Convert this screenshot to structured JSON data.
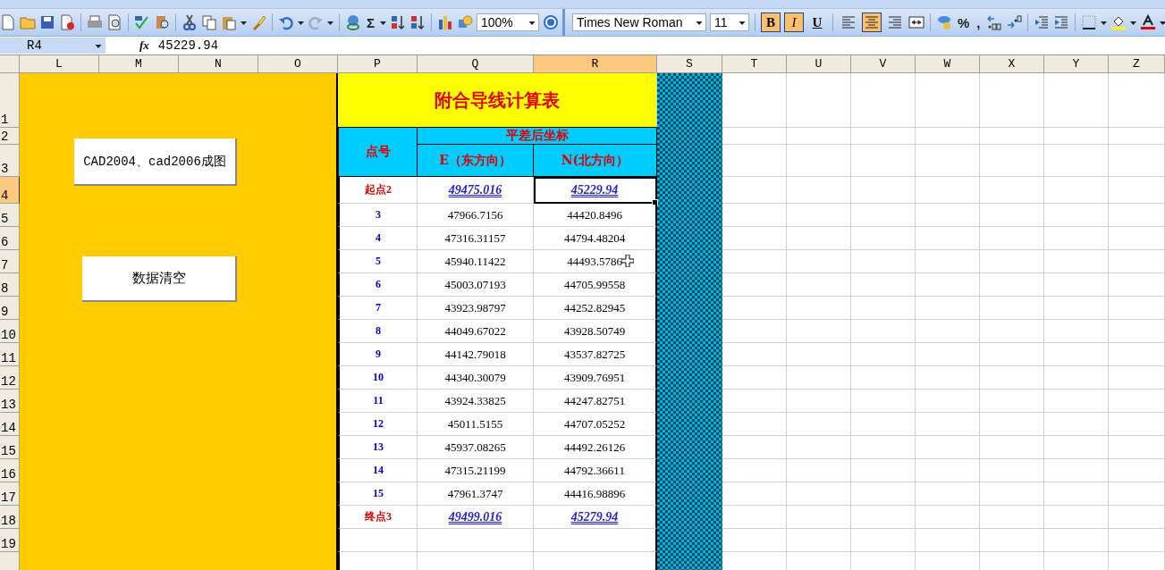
{
  "toolbar": {
    "sigma": "Σ",
    "zoom": "100%",
    "font": "Times New Roman",
    "font_size": "11",
    "style_buttons": [
      {
        "label": "B",
        "selected": true
      },
      {
        "label": "I",
        "selected": true
      },
      {
        "label": "U",
        "selected": false
      }
    ],
    "alignment": [
      {
        "selected": false
      },
      {
        "selected": true
      },
      {
        "selected": false
      }
    ],
    "percent": "%",
    "comma": ","
  },
  "formula_bar": {
    "name_box": "R4",
    "fx": "fx",
    "formula": "45229.94"
  },
  "columns": [
    {
      "label": "L",
      "selected": false
    },
    {
      "label": "M",
      "selected": false
    },
    {
      "label": "N",
      "selected": false
    },
    {
      "label": "O",
      "selected": false
    },
    {
      "label": "P",
      "selected": false
    },
    {
      "label": "Q",
      "selected": false
    },
    {
      "label": "R",
      "selected": true
    },
    {
      "label": "S",
      "selected": false
    },
    {
      "label": "T",
      "selected": false
    },
    {
      "label": "U",
      "selected": false
    },
    {
      "label": "V",
      "selected": false
    },
    {
      "label": "W",
      "selected": false
    },
    {
      "label": "X",
      "selected": false
    },
    {
      "label": "Y",
      "selected": false
    },
    {
      "label": "Z",
      "selected": false
    }
  ],
  "row_numbers": [
    {
      "label": "1",
      "selected": false
    },
    {
      "label": "2",
      "selected": false
    },
    {
      "label": "3",
      "selected": false
    },
    {
      "label": "4",
      "selected": true
    },
    {
      "label": "5",
      "selected": false
    },
    {
      "label": "6",
      "selected": false
    },
    {
      "label": "7",
      "selected": false
    },
    {
      "label": "8",
      "selected": false
    },
    {
      "label": "9",
      "selected": false
    },
    {
      "label": "10",
      "selected": false
    },
    {
      "label": "11",
      "selected": false
    },
    {
      "label": "12",
      "selected": false
    },
    {
      "label": "13",
      "selected": false
    },
    {
      "label": "14",
      "selected": false
    },
    {
      "label": "15",
      "selected": false
    },
    {
      "label": "16",
      "selected": false
    },
    {
      "label": "17",
      "selected": false
    },
    {
      "label": "18",
      "selected": false
    },
    {
      "label": "19",
      "selected": false
    }
  ],
  "macro_buttons": [
    "CAD2004、cad2006成图",
    "数据清空"
  ],
  "table": {
    "title": "附合导线计算表",
    "point_header": "点号",
    "group_header": "平差后坐标",
    "columns": [
      "E（东方向）",
      "N(北方向）"
    ],
    "rows": [
      {
        "point": "起点2",
        "kind": "control",
        "e": "49475.016",
        "n": "45229.94",
        "selected": true
      },
      {
        "point": "3",
        "kind": "normal",
        "e": "47966.7156",
        "n": "44420.8496",
        "selected": false
      },
      {
        "point": "4",
        "kind": "normal",
        "e": "47316.31157",
        "n": "44794.48204",
        "selected": false
      },
      {
        "point": "5",
        "kind": "normal",
        "e": "45940.11422",
        "n": "44493.5786",
        "selected": false
      },
      {
        "point": "6",
        "kind": "normal",
        "e": "45003.07193",
        "n": "44705.99558",
        "selected": false
      },
      {
        "point": "7",
        "kind": "normal",
        "e": "43923.98797",
        "n": "44252.82945",
        "selected": false
      },
      {
        "point": "8",
        "kind": "normal",
        "e": "44049.67022",
        "n": "43928.50749",
        "selected": false
      },
      {
        "point": "9",
        "kind": "normal",
        "e": "44142.79018",
        "n": "43537.82725",
        "selected": false
      },
      {
        "point": "10",
        "kind": "normal",
        "e": "44340.30079",
        "n": "43909.76951",
        "selected": false
      },
      {
        "point": "11",
        "kind": "normal",
        "e": "43924.33825",
        "n": "44247.82751",
        "selected": false
      },
      {
        "point": "12",
        "kind": "normal",
        "e": "45011.5155",
        "n": "44707.05252",
        "selected": false
      },
      {
        "point": "13",
        "kind": "normal",
        "e": "45937.08265",
        "n": "44492.26126",
        "selected": false
      },
      {
        "point": "14",
        "kind": "normal",
        "e": "47315.21199",
        "n": "44792.36611",
        "selected": false
      },
      {
        "point": "15",
        "kind": "normal",
        "e": "47961.3747",
        "n": "44416.98896",
        "selected": false
      },
      {
        "point": "终点3",
        "kind": "control",
        "e": "49499.016",
        "n": "45279.94",
        "selected": false
      }
    ]
  }
}
